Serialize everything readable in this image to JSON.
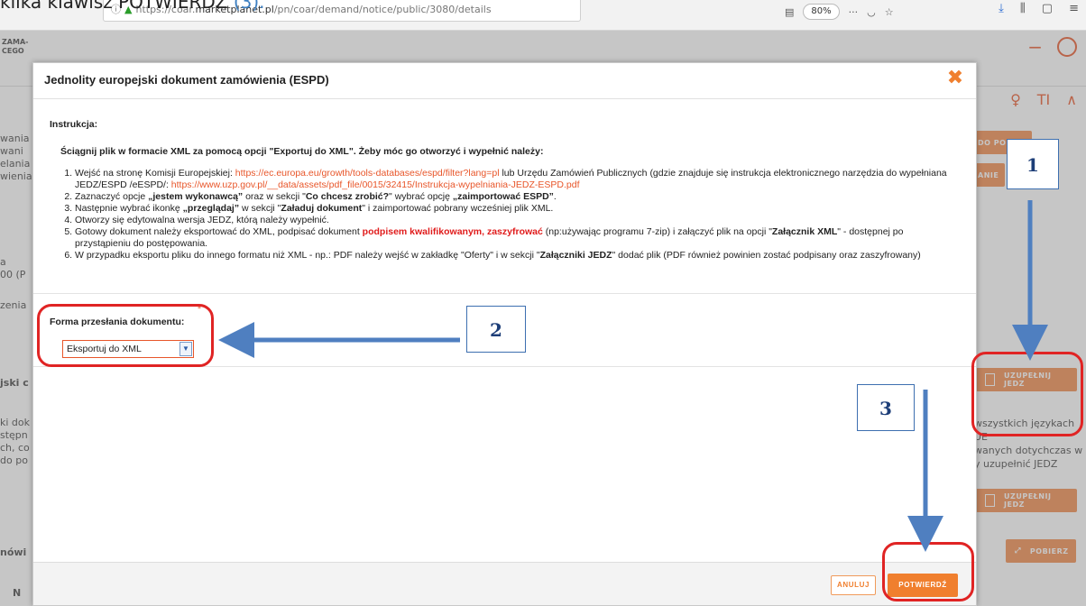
{
  "caption": {
    "prefix": "klika klawisz POTWIERDŹ ",
    "highlight": "(3)."
  },
  "browser": {
    "url_prefix": "https://coar.",
    "url_domain": "marketplanet.pl",
    "url_path": "/pn/coar/demand/notice/public/3080/details",
    "zoom": "80%",
    "more": "···"
  },
  "background": {
    "logo_line1": "ZAMA-",
    "logo_line2": "CEGO",
    "left_fragments": [
      "wania",
      "wani",
      "elania",
      "wienia",
      "a",
      "00 (P",
      "zenia",
      "jski c",
      "ki dok",
      "stępn",
      "ch, co",
      "do po",
      "nówi",
      "N"
    ],
    "right_text_lines": [
      "wszystkich językach UE",
      "wanych dotychczas w",
      "y uzupełnić JEDZ"
    ],
    "btn_do_po": "DO PO",
    "btn_anie": "ANIE",
    "btn_uzupelnij_1": "UZUPEŁNIJ JEDZ",
    "btn_uzupelnij_2": "UZUPEŁNIJ JEDZ",
    "btn_pobierz": "POBIERZ"
  },
  "modal": {
    "title": "Jednolity europejski dokument zamówienia (ESPD)",
    "instruction_label": "Instrukcja:",
    "instruction_heading": "Ściągnij plik w formacie XML za pomocą opcji \"Exportuj do XML\". Żeby móc go otworzyć i wypełnić należy:",
    "steps": {
      "s1_a": "Wejść na stronę Komisji Europejskiej: ",
      "s1_link1": "https://ec.europa.eu/growth/tools-databases/espd/filter?lang=pl",
      "s1_b": " lub Urzędu Zamówień Publicznych (gdzie znajduje się instrukcja elektronicznego narzędzia do wypełniana JEDZ/ESPD /eESPD/: ",
      "s1_link2": "https://www.uzp.gov.pl/__data/assets/pdf_file/0015/32415/Instrukcja-wypelniania-JEDZ-ESPD.pdf",
      "s2_a": "Zaznaczyć opcje ",
      "s2_b": "„jestem wykonawcą”",
      "s2_c": " oraz w sekcji \"",
      "s2_d": "Co chcesz zrobić?",
      "s2_e": "\" wybrać opcję ",
      "s2_f": "„zaimportować ESPD”",
      "s2_g": ".",
      "s3_a": "Następnie wybrać ikonkę ",
      "s3_b": "„przeglądaj”",
      "s3_c": " w sekcji \"",
      "s3_d": "Załaduj dokument",
      "s3_e": "\" i zaimportować pobrany wcześniej plik XML.",
      "s4": "Otworzy się edytowalna wersja JEDZ, którą należy wypełnić.",
      "s5_a": "Gotowy dokument należy eksportować do XML, podpisać dokument ",
      "s5_red1": "podpisem kwalifikowanym",
      "s5_sep": ", ",
      "s5_red2": "zaszyfrować",
      "s5_b": " (np:używając programu 7-zip) i załączyć plik na opcji \"",
      "s5_c": "Załącznik XML",
      "s5_d": "\" - dostępnej po przystąpieniu do postępowania.",
      "s6_a": "W przypadku eksportu pliku do innego formatu niż XML - np.: PDF należy wejść w zakładkę \"Oferty\" i w sekcji \"",
      "s6_b": "Załączniki JEDZ",
      "s6_c": "\" dodać plik (PDF również powinien zostać podpisany oraz zaszyfrowany)"
    },
    "form_label": "Forma przesłania dokumentu:",
    "required_mark": "*",
    "select_value": "Eksportuj do XML",
    "cancel_label": "ANULUJ",
    "confirm_label": "POTWIERDŹ"
  },
  "annotations": {
    "n1": "1",
    "n2": "2",
    "n3": "3",
    "ring_color": "#e02424",
    "arrow_color": "#4f7fc0"
  }
}
